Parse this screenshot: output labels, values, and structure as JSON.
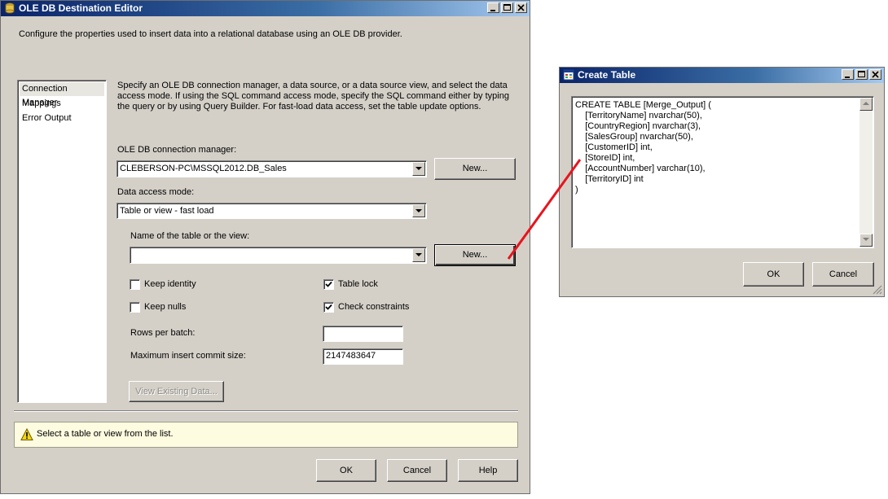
{
  "main_window": {
    "title": "OLE DB Destination Editor",
    "description": "Configure the properties used to insert data into a relational database using an OLE DB provider.",
    "nav_items": [
      "Connection Manager",
      "Mappings",
      "Error Output"
    ],
    "selected_nav": "Connection Manager",
    "instructions_line1": "Specify an OLE DB connection manager, a data source, or a data source view, and select the data",
    "instructions_line2": "access mode. If using the SQL command access mode, specify the SQL command either by typing",
    "instructions_line3": "the query or by using Query Builder. For fast-load data access, set the table update options.",
    "connection_manager_label": "OLE DB connection manager:",
    "connection_manager_value": "CLEBERSON-PC\\MSSQL2012.DB_Sales",
    "new_button_1": "New...",
    "access_mode_label": "Data access mode:",
    "access_mode_value": "Table or view - fast load",
    "table_name_label": "Name of the table or the view:",
    "table_name_value": "",
    "new_button_2": "New...",
    "keep_identity": {
      "label": "Keep identity",
      "checked": false
    },
    "keep_nulls": {
      "label": "Keep nulls",
      "checked": false
    },
    "table_lock": {
      "label": "Table lock",
      "checked": true
    },
    "check_constraints": {
      "label": "Check constraints",
      "checked": true
    },
    "rows_per_batch_label": "Rows per batch:",
    "rows_per_batch_value": "",
    "max_commit_label": "Maximum insert commit size:",
    "max_commit_value": "2147483647",
    "view_existing_data": "View Existing Data...",
    "status_message": "Select a table or view from the list.",
    "ok": "OK",
    "cancel": "Cancel",
    "help": "Help"
  },
  "create_table_dialog": {
    "title": "Create Table",
    "sql": "CREATE TABLE [Merge_Output] (\n    [TerritoryName] nvarchar(50),\n    [CountryRegion] nvarchar(3),\n    [SalesGroup] nvarchar(50),\n    [CustomerID] int,\n    [StoreID] int,\n    [AccountNumber] varchar(10),\n    [TerritoryID] int\n)",
    "ok": "OK",
    "cancel": "Cancel"
  },
  "colors": {
    "annotation_arrow": "#e8141e",
    "titlebar_start": "#0a246a",
    "dialog_face": "#d4d0c8",
    "status_background": "#fdfbe0"
  },
  "icons": [
    "app-icon",
    "minimize-icon",
    "maximize-icon",
    "close-icon",
    "warning-icon",
    "dropdown-arrow-icon",
    "checkmark-icon",
    "resize-grip-icon"
  ]
}
